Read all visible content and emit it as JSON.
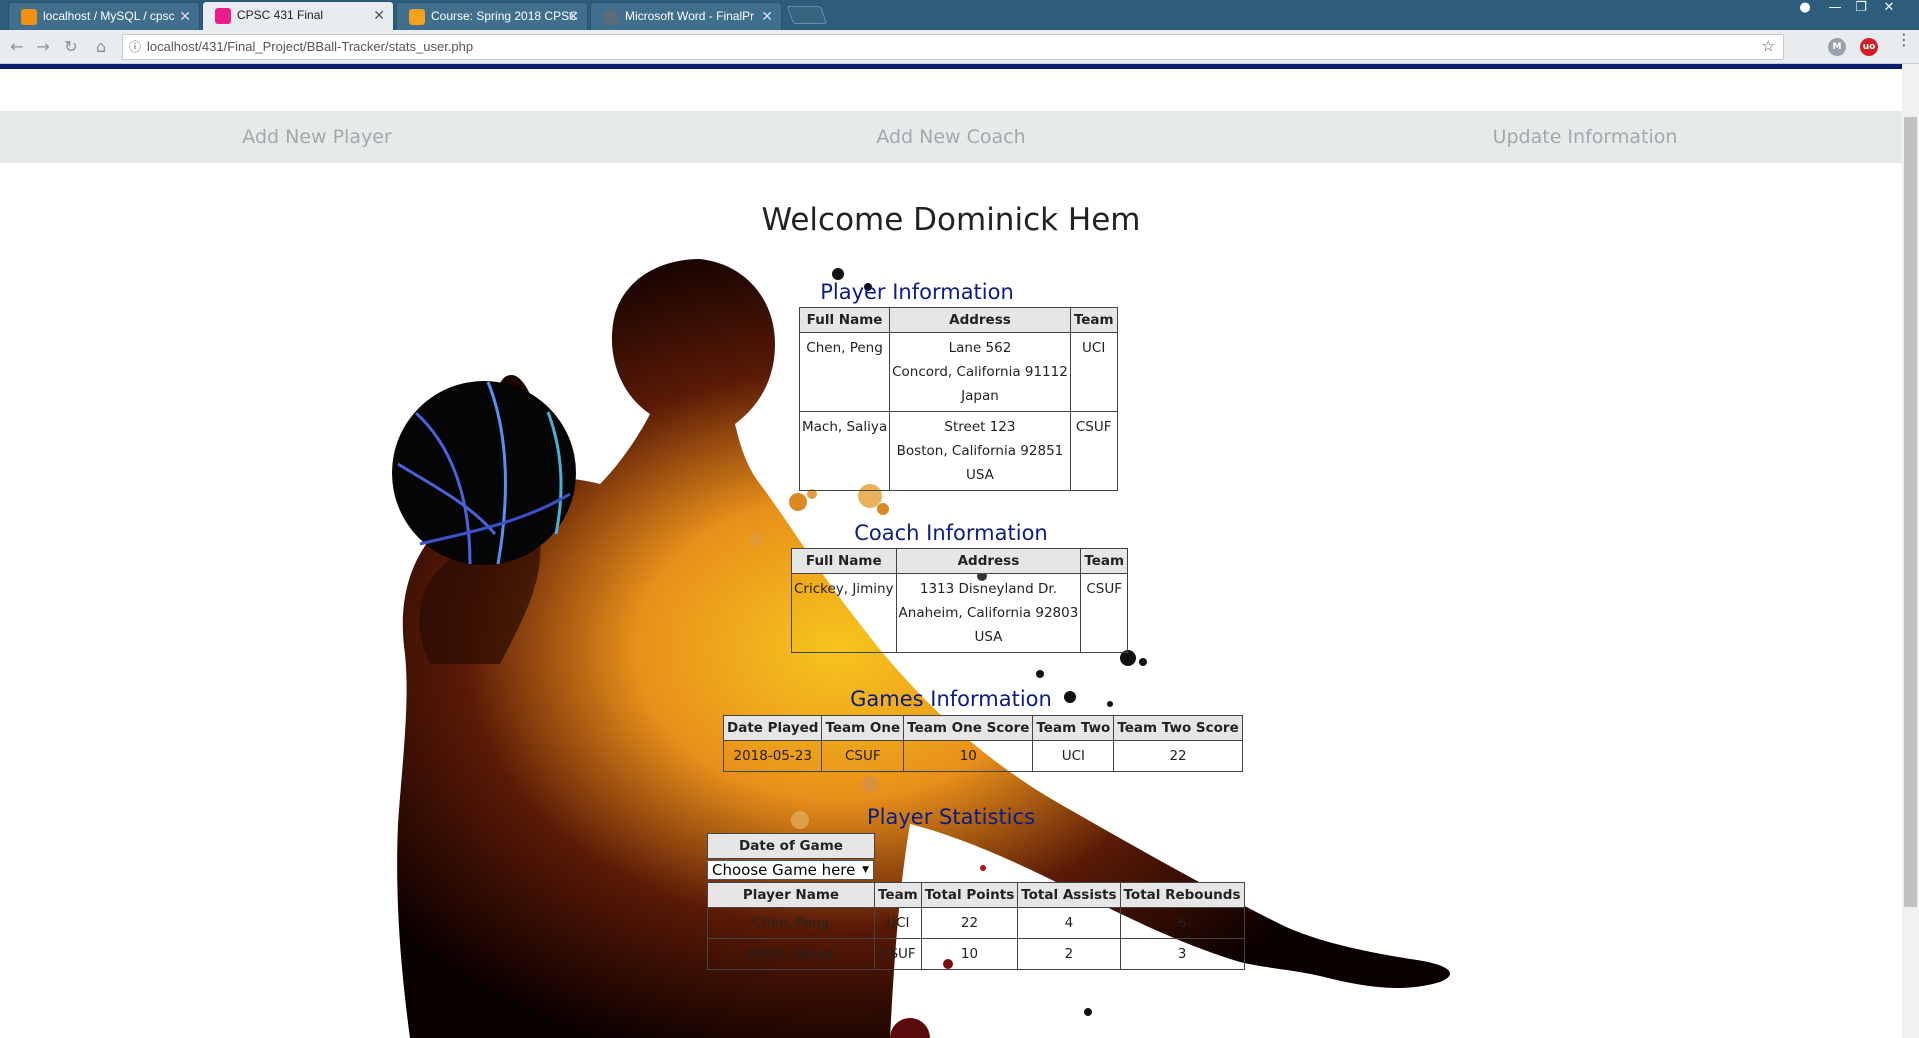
{
  "browser": {
    "tabs": [
      {
        "title": "localhost / MySQL / cpsc",
        "favicon_color": "#f29111"
      },
      {
        "title": "CPSC 431 Final",
        "favicon_color": "#e91e8c"
      },
      {
        "title": "Course: Spring 2018 CPSC",
        "favicon_color": "#f7a21b"
      },
      {
        "title": "Microsoft Word - FinalPr",
        "favicon_color": "#5c6b7a"
      }
    ],
    "url": "localhost/431/Final_Project/BBall-Tracker/stats_user.php",
    "close_glyph": "✕",
    "nav_glyphs": {
      "back": "←",
      "forward": "→",
      "reload": "↻",
      "home": "⌂"
    },
    "star_glyph": "☆",
    "info_glyph": "ⓘ",
    "ext1_label": "M",
    "ext2_label": "uo"
  },
  "nav": {
    "add_player": "Add New Player",
    "add_coach": "Add New Coach",
    "update_info": "Update Information"
  },
  "welcome": "Welcome Dominick Hem",
  "players": {
    "title": "Player Information",
    "headers": [
      "Full Name",
      "Address",
      "Team"
    ],
    "rows": [
      {
        "name": "Chen, Peng",
        "street": "Lane 562",
        "city": "Concord, California 91112",
        "country": "Japan",
        "team": "UCI"
      },
      {
        "name": "Mach, Saliya",
        "street": "Street 123",
        "city": "Boston, California 92851",
        "country": "USA",
        "team": "CSUF"
      }
    ]
  },
  "coaches": {
    "title": "Coach Information",
    "headers": [
      "Full Name",
      "Address",
      "Team"
    ],
    "rows": [
      {
        "name": "Crickey, Jiminy",
        "street": "1313 Disneyland Dr.",
        "city": "Anaheim, California 92803",
        "country": "USA",
        "team": "CSUF"
      }
    ]
  },
  "games": {
    "title": "Games Information",
    "headers": [
      "Date Played",
      "Team One",
      "Team One Score",
      "Team Two",
      "Team Two Score"
    ],
    "rows": [
      {
        "date": "2018-05-23",
        "team_one": "CSUF",
        "team_one_score": "10",
        "team_two": "UCI",
        "team_two_score": "22"
      }
    ]
  },
  "stats": {
    "title": "Player Statistics",
    "date_header": "Date of Game",
    "select_value": "Choose Game here",
    "headers": [
      "Player Name",
      "Team",
      "Total Points",
      "Total Assists",
      "Total Rebounds"
    ],
    "rows": [
      {
        "name": "Chen, Peng",
        "team": "UCI",
        "points": "22",
        "assists": "4",
        "rebounds": "6"
      },
      {
        "name": "Mach, Saliya",
        "team": "CSUF",
        "points": "10",
        "assists": "2",
        "rebounds": "3"
      }
    ]
  },
  "colors": {
    "title_blue": "#0b1d80",
    "nav_bg": "#e7eaea",
    "nav_text": "#a2a9ab",
    "top_line": "#0a1e6e"
  }
}
